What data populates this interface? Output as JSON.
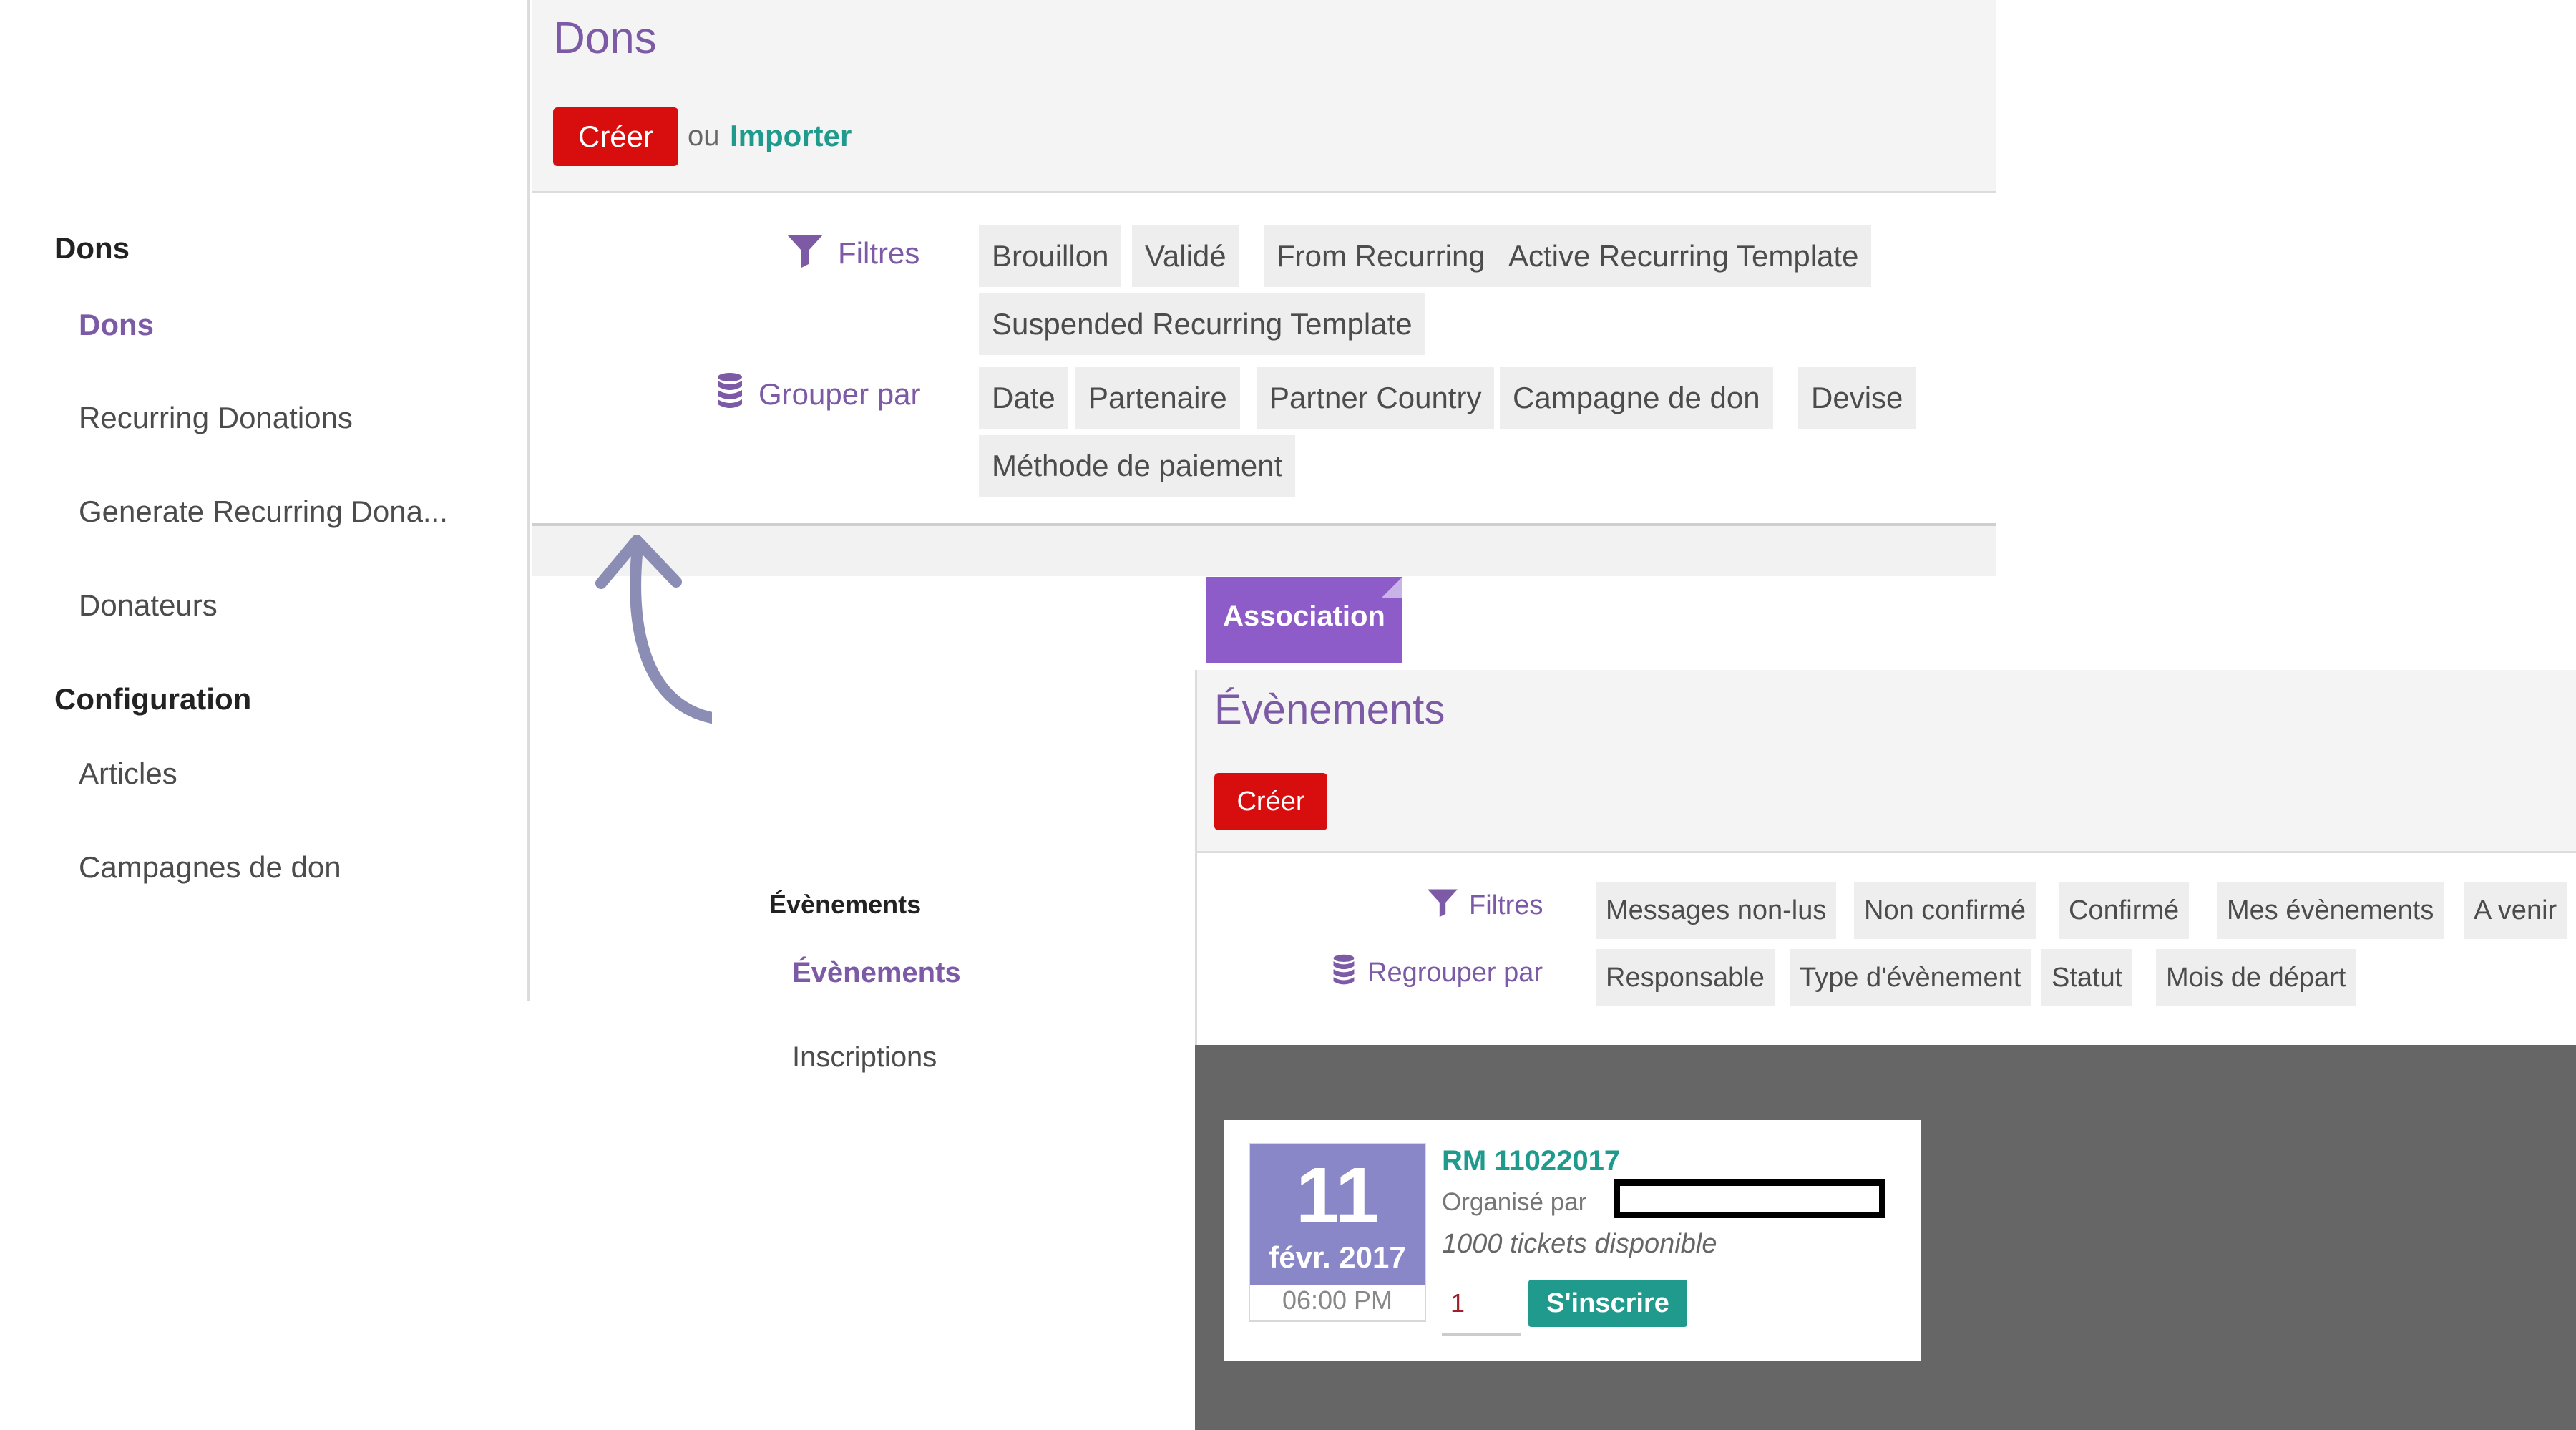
{
  "dons": {
    "sidebar": {
      "section_dons": "Dons",
      "items": [
        "Dons",
        "Recurring Donations",
        "Generate Recurring Dona...",
        "Donateurs"
      ],
      "section_configuration": "Configuration",
      "config_items": [
        "Articles",
        "Campagnes de don"
      ]
    },
    "title": "Dons",
    "create_label": "Créer",
    "or_label": "ou",
    "import_label": "Importer",
    "filters_label": "Filtres",
    "filters": [
      "Brouillon",
      "Validé",
      "From Recurring",
      "Active Recurring Template",
      "Suspended Recurring Template"
    ],
    "groupby_label": "Grouper par",
    "groupby": [
      "Date",
      "Partenaire",
      "Partner Country",
      "Campagne de don",
      "Devise",
      "Méthode de paiement"
    ]
  },
  "events": {
    "tab_label": "Association",
    "title": "Évènements",
    "create_label": "Créer",
    "sidebar": {
      "section": "Évènements",
      "items": [
        "Évènements",
        "Inscriptions"
      ]
    },
    "filters_label": "Filtres",
    "filters": [
      "Messages non-lus",
      "Non confirmé",
      "Confirmé",
      "Mes évènements",
      "A venir"
    ],
    "groupby_label": "Regrouper par",
    "groupby": [
      "Responsable",
      "Type d'évènement",
      "Statut",
      "Mois de départ"
    ],
    "card": {
      "day": "11",
      "month_year": "févr. 2017",
      "time": "06:00 PM",
      "name": "RM 11022017",
      "organizer_label": "Organisé par",
      "tickets": "1000 tickets disponible",
      "quantity": "1",
      "register_label": "S'inscrire"
    }
  },
  "colors": {
    "accent_purple": "#7c5aa6",
    "button_red": "#d80e0e",
    "link_teal": "#1f9a8c",
    "tab_purple": "#8e5cc8",
    "date_purple": "#8a87c9"
  }
}
